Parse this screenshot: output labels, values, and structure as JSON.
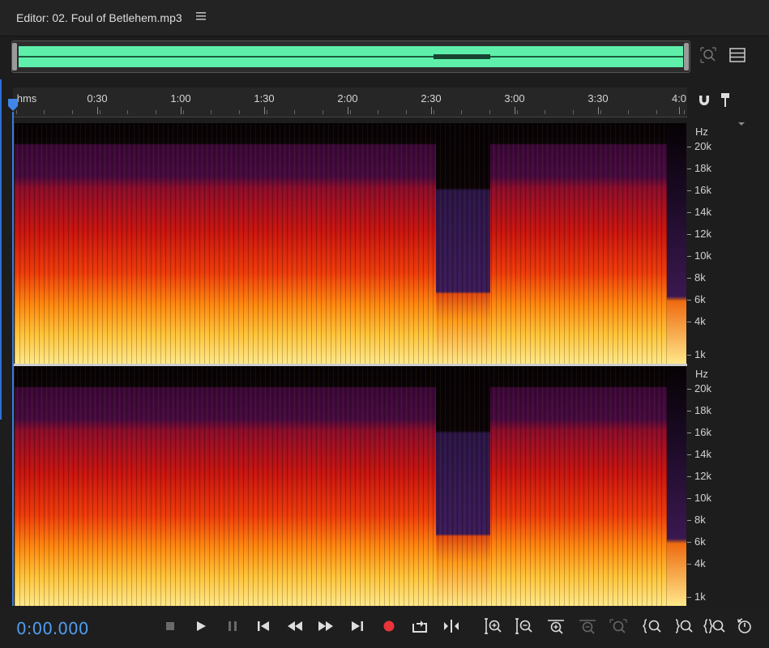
{
  "editor": {
    "title": "Editor: 02. Foul of Betlehem.mp3"
  },
  "colors": {
    "accent": "#4f9cf0",
    "waveform": "#5ef0aa",
    "record": "#e8343a",
    "spectrogram_hot": "#ffe27a",
    "spectrogram_mid": "#e8300e",
    "spectrogram_cool": "#4a1060"
  },
  "timeline": {
    "labels": [
      "hms",
      "0:30",
      "1:00",
      "1:30",
      "2:00",
      "2:30",
      "3:00",
      "3:30",
      "4:0"
    ]
  },
  "channels": [
    {
      "unit": "Hz",
      "labels": [
        "20k",
        "18k",
        "16k",
        "14k",
        "12k",
        "10k",
        "8k",
        "6k",
        "4k",
        "1k"
      ]
    },
    {
      "unit": "Hz",
      "labels": [
        "20k",
        "18k",
        "16k",
        "14k",
        "12k",
        "10k",
        "8k",
        "6k",
        "4k",
        "1k"
      ]
    }
  ],
  "transport": {
    "timecode": "0:00.000"
  },
  "icons": {
    "title_menu": "hamburger-icon",
    "overview_zoom": "zoom-selection-icon",
    "panel_rows": "rows-icon",
    "timeline_snap": "magnet-icon",
    "timeline_marker": "marker-pin-icon",
    "transport": [
      "stop-icon",
      "play-icon",
      "pause-icon",
      "skip-to-start-icon",
      "rewind-icon",
      "fast-forward-icon",
      "skip-to-end-icon",
      "record-icon",
      "loop-icon",
      "skip-selection-icon",
      "zoom-in-amplitude-icon",
      "zoom-out-amplitude-icon",
      "zoom-in-time-icon",
      "zoom-out-time-icon",
      "zoom-out-full-icon",
      "zoom-in-left-icon",
      "zoom-in-right-icon",
      "zoom-selection-icon",
      "zoom-reset-icon"
    ]
  }
}
